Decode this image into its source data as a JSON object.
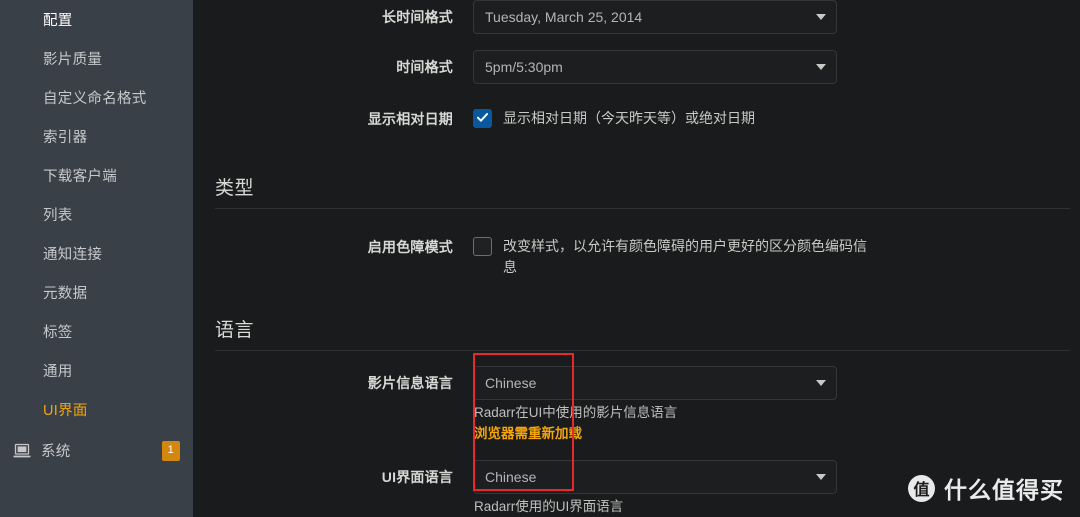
{
  "sidebar": {
    "items": [
      {
        "label": "配置",
        "active": false
      },
      {
        "label": "影片质量",
        "active": false
      },
      {
        "label": "自定义命名格式",
        "active": false
      },
      {
        "label": "索引器",
        "active": false
      },
      {
        "label": "下载客户端",
        "active": false
      },
      {
        "label": "列表",
        "active": false
      },
      {
        "label": "通知连接",
        "active": false
      },
      {
        "label": "元数据",
        "active": false
      },
      {
        "label": "标签",
        "active": false
      },
      {
        "label": "通用",
        "active": false
      },
      {
        "label": "UI界面",
        "active": true
      }
    ],
    "system": {
      "label": "系统",
      "icon": "monitor-icon",
      "badge": "1"
    },
    "active_color": "#f2a50c",
    "background": "#3a4047"
  },
  "main": {
    "dates": {
      "long_date_format": {
        "label": "长时间格式",
        "value": "Tuesday, March 25, 2014"
      },
      "time_format": {
        "label": "时间格式",
        "value": "5pm/5:30pm"
      },
      "relative_dates": {
        "label": "显示相对日期",
        "checkbox_text": "显示相对日期（今天昨天等）或绝对日期",
        "checked": true
      }
    },
    "style_section": {
      "title": "类型",
      "colorblind": {
        "label": "启用色障模式",
        "checkbox_text": "改变样式，以允许有颜色障碍的用户更好的区分颜色编码信息",
        "checked": false
      }
    },
    "language_section": {
      "title": "语言",
      "movie_info_language": {
        "label": "影片信息语言",
        "value": "Chinese",
        "help": "Radarr在UI中使用的影片信息语言",
        "warning": "浏览器需重新加载"
      },
      "ui_language": {
        "label": "UI界面语言",
        "value": "Chinese",
        "help": "Radarr使用的UI界面语言"
      }
    }
  },
  "annotation": {
    "color": "#e8282d",
    "name": "red-highlight-rectangle"
  },
  "watermark": {
    "mark": "值",
    "text": "什么值得买"
  }
}
